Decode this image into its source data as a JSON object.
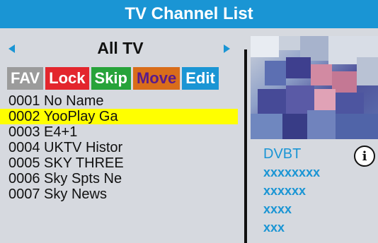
{
  "header": {
    "title": "TV Channel List"
  },
  "group": {
    "name": "All TV"
  },
  "buttons": {
    "fav": "FAV",
    "lock": "Lock",
    "skip": "Skip",
    "move": "Move",
    "edit": "Edit"
  },
  "channels": [
    {
      "label": "0001 No Name"
    },
    {
      "label": "0002 YooPlay Ga"
    },
    {
      "label": "0003 E4+1"
    },
    {
      "label": "0004 UKTV Histor"
    },
    {
      "label": "0005 SKY THREE"
    },
    {
      "label": "0006 Sky Spts Ne"
    },
    {
      "label": "0007 Sky News"
    }
  ],
  "selected_channel": "0002 YooPlay Ga",
  "info": {
    "type": "DVBT",
    "line1": "xxxxxxxx",
    "line2": "xxxxxx",
    "line3": "xxxx",
    "line4": "xxx"
  },
  "icons": {
    "info": "info-icon",
    "prev": "left-arrow-icon",
    "next": "right-arrow-icon"
  },
  "colors": {
    "accent": "#1a95d4",
    "selected": "#ffff00",
    "lock": "#e3262d",
    "skip": "#27a33a",
    "move": "#d96d1a"
  }
}
